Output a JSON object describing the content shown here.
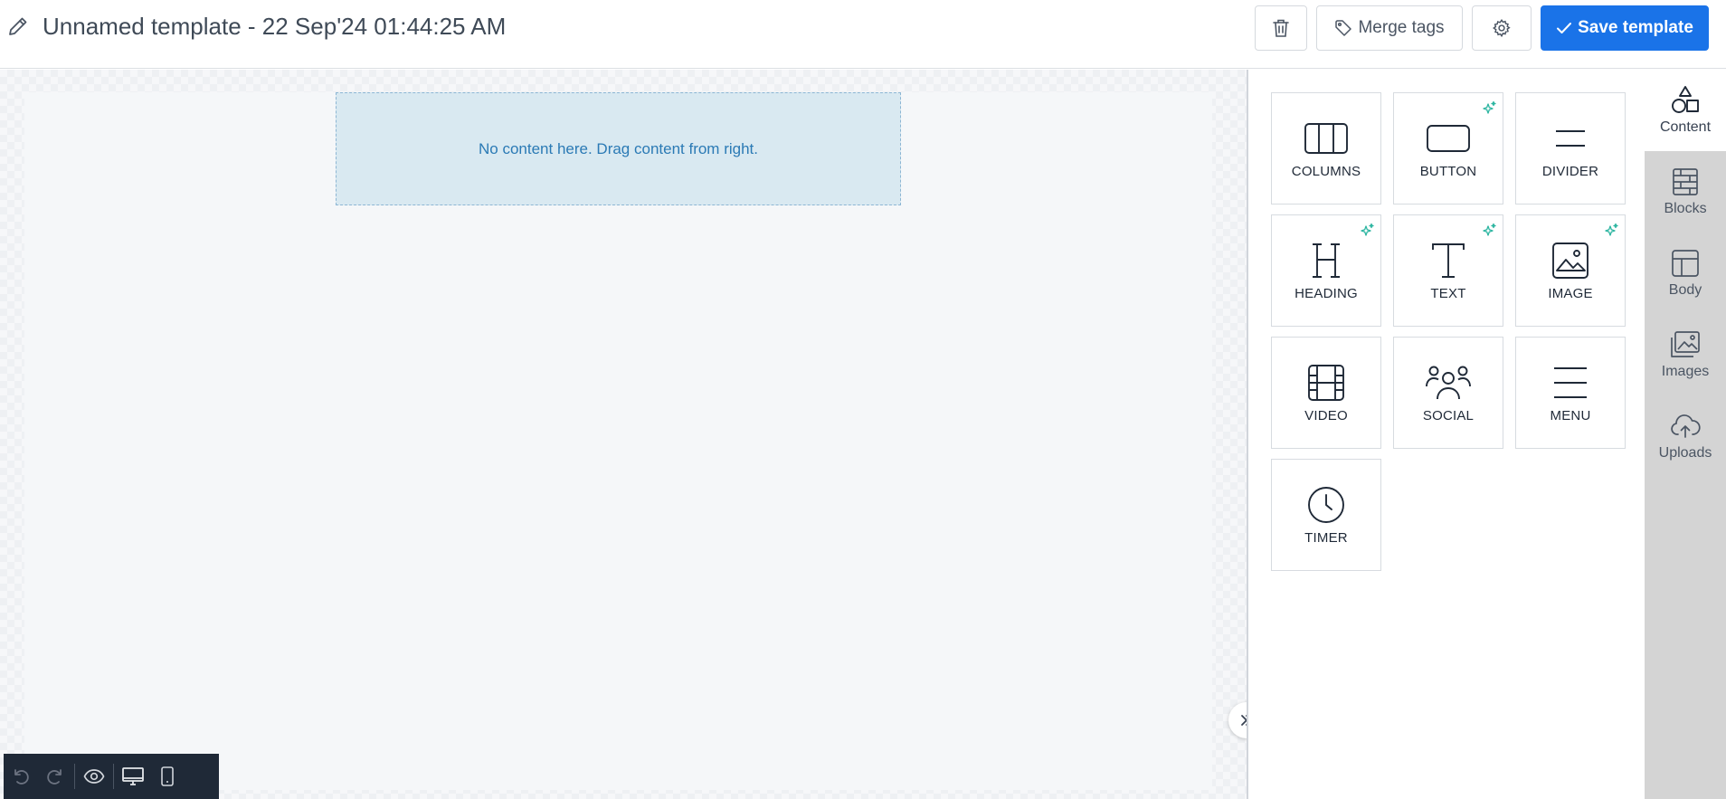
{
  "header": {
    "title": "Unnamed template - 22 Sep'24 01:44:25 AM",
    "merge_tags_label": "Merge tags",
    "save_label": "Save template"
  },
  "canvas": {
    "empty_message": "No content here. Drag content from right."
  },
  "content_tiles": [
    {
      "label": "COLUMNS",
      "icon": "columns-icon",
      "sparkle": false
    },
    {
      "label": "BUTTON",
      "icon": "button-icon",
      "sparkle": true
    },
    {
      "label": "DIVIDER",
      "icon": "divider-icon",
      "sparkle": false
    },
    {
      "label": "HEADING",
      "icon": "heading-icon",
      "sparkle": true
    },
    {
      "label": "TEXT",
      "icon": "text-icon",
      "sparkle": true
    },
    {
      "label": "IMAGE",
      "icon": "image-icon",
      "sparkle": true
    },
    {
      "label": "VIDEO",
      "icon": "video-icon",
      "sparkle": false
    },
    {
      "label": "SOCIAL",
      "icon": "social-icon",
      "sparkle": false
    },
    {
      "label": "MENU",
      "icon": "menu-icon",
      "sparkle": false
    },
    {
      "label": "TIMER",
      "icon": "timer-icon",
      "sparkle": false
    }
  ],
  "rail_tabs": [
    {
      "label": "Content",
      "icon": "shapes-icon",
      "active": true
    },
    {
      "label": "Blocks",
      "icon": "blocks-icon",
      "active": false
    },
    {
      "label": "Body",
      "icon": "layout-icon",
      "active": false
    },
    {
      "label": "Images",
      "icon": "images-icon",
      "active": false
    },
    {
      "label": "Uploads",
      "icon": "cloud-upload-icon",
      "active": false
    }
  ],
  "colors": {
    "primary": "#1a73e8",
    "dropzone_bg": "#d9e9f1",
    "dropzone_text": "#2b7ab5",
    "sparkle": "#2bb5a0",
    "toolbar_bg": "#1f2937"
  }
}
